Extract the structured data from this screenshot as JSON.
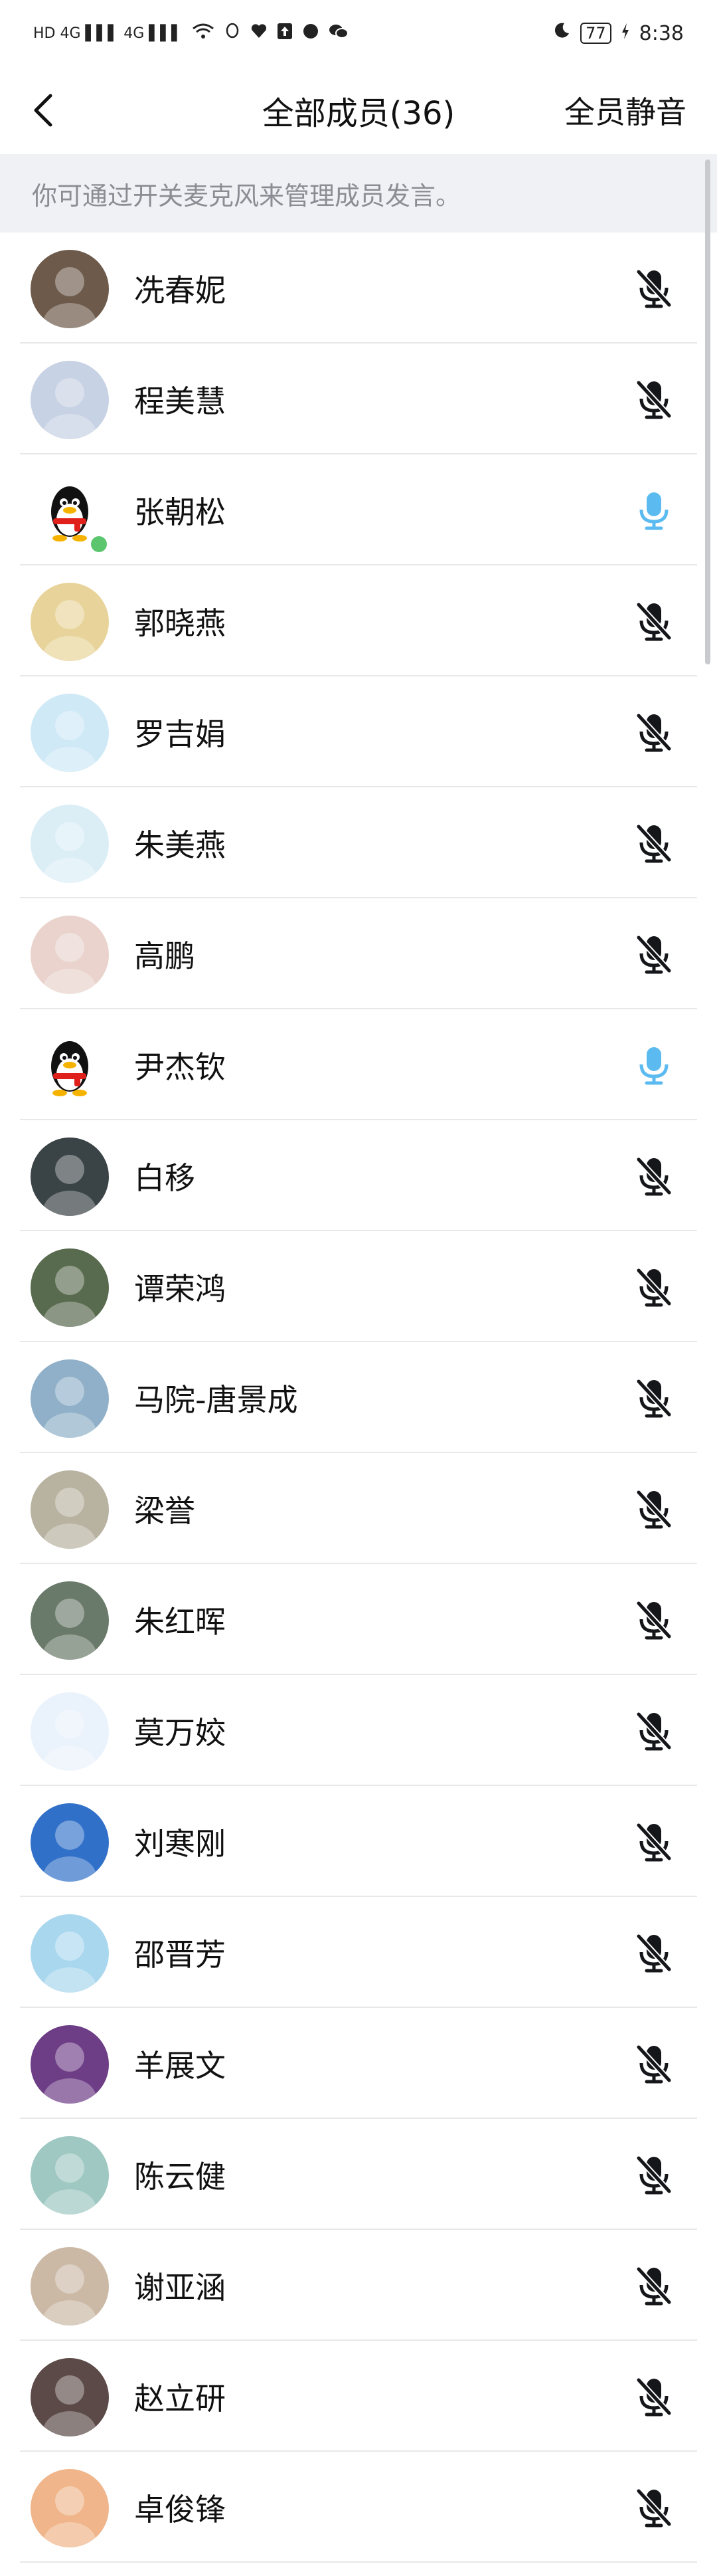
{
  "status_bar": {
    "left_indicators": "HD 4G ▌▌▌ 4G ▌▌▌",
    "battery": "77",
    "time": "8:38"
  },
  "header": {
    "title": "全部成员(36)",
    "mute_all_label": "全员静音"
  },
  "notice": "你可通过开关麦克风来管理成员发言。",
  "colors": {
    "accent_mic_on": "#5bbbf0",
    "mic_off": "#15161a",
    "notice_bg": "#f0f1f4"
  },
  "members": [
    {
      "name": "冼春妮",
      "mic": "off",
      "avatar_bg": "#6d5a4a"
    },
    {
      "name": "程美慧",
      "mic": "off",
      "avatar_bg": "#c7d2e4"
    },
    {
      "name": "张朝松",
      "mic": "on",
      "avatar_bg": "#ffffff"
    },
    {
      "name": "郭晓燕",
      "mic": "off",
      "avatar_bg": "#e8d49a"
    },
    {
      "name": "罗吉娟",
      "mic": "off",
      "avatar_bg": "#cfe9f7"
    },
    {
      "name": "朱美燕",
      "mic": "off",
      "avatar_bg": "#dbeef6"
    },
    {
      "name": "高鹏",
      "mic": "off",
      "avatar_bg": "#e9d3cc"
    },
    {
      "name": "尹杰钦",
      "mic": "on",
      "avatar_bg": "#ffffff"
    },
    {
      "name": "白移",
      "mic": "off",
      "avatar_bg": "#3a4346"
    },
    {
      "name": "谭荣鸿",
      "mic": "off",
      "avatar_bg": "#596b4f"
    },
    {
      "name": "马院-唐景成",
      "mic": "off",
      "avatar_bg": "#8fb0c8"
    },
    {
      "name": "梁誉",
      "mic": "off",
      "avatar_bg": "#b8b2a0"
    },
    {
      "name": "朱红晖",
      "mic": "off",
      "avatar_bg": "#6a7a6a"
    },
    {
      "name": "莫万姣",
      "mic": "off",
      "avatar_bg": "#eaf2fb"
    },
    {
      "name": "刘寒刚",
      "mic": "off",
      "avatar_bg": "#3170c9"
    },
    {
      "name": "邵晋芳",
      "mic": "off",
      "avatar_bg": "#a9d7ee"
    },
    {
      "name": "羊展文",
      "mic": "off",
      "avatar_bg": "#6d3d86"
    },
    {
      "name": "陈云健",
      "mic": "off",
      "avatar_bg": "#9fc8c2"
    },
    {
      "name": "谢亚涵",
      "mic": "off",
      "avatar_bg": "#cbb9a6"
    },
    {
      "name": "赵立研",
      "mic": "off",
      "avatar_bg": "#5b4a47"
    },
    {
      "name": "卓俊锋",
      "mic": "off",
      "avatar_bg": "#f0b58a"
    }
  ]
}
